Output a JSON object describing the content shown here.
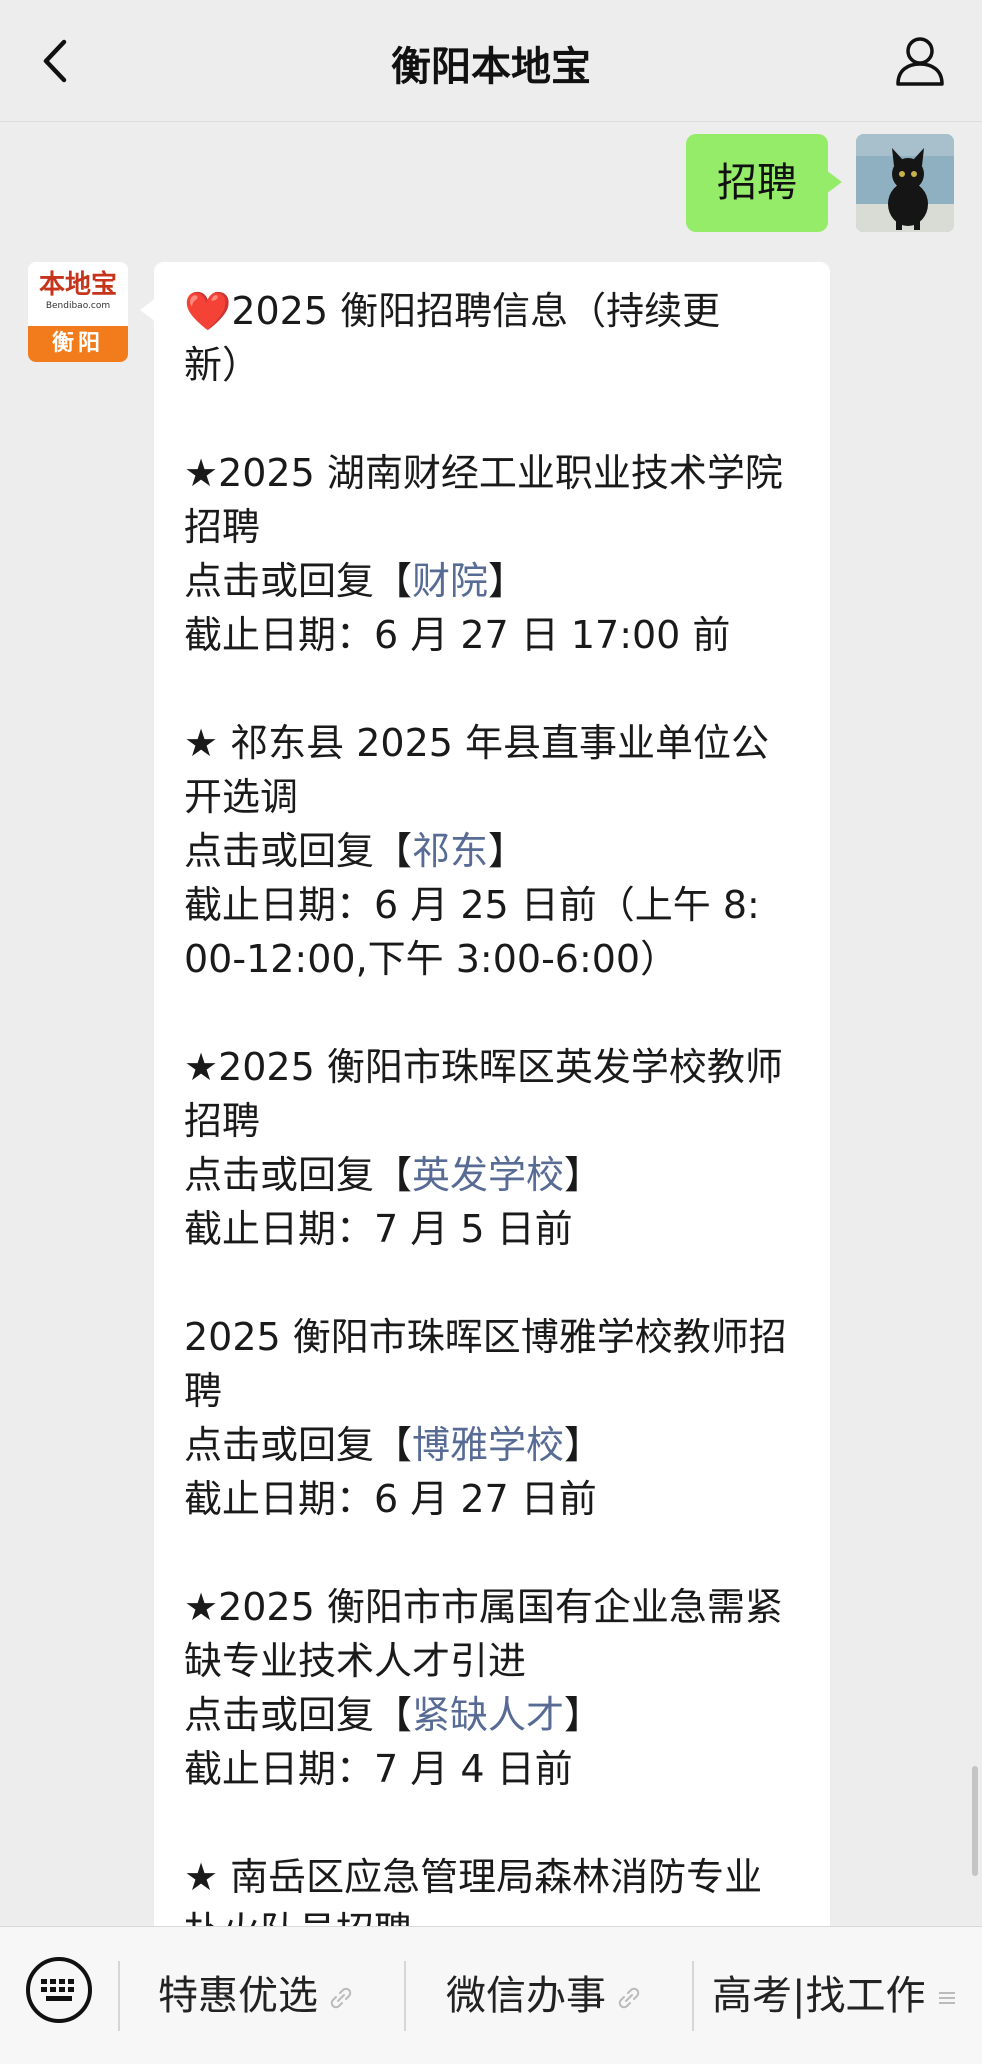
{
  "header": {
    "title": "衡阳本地宝"
  },
  "outgoing_message": {
    "text": "招聘"
  },
  "sender_logo": {
    "main": "本地宝",
    "sub": "Bendibao.com",
    "city": "衡阳"
  },
  "incoming_message": {
    "heart": "❤️",
    "title_line1": "2025 衡阳招聘信息（持续更",
    "title_line2": "新）",
    "items": [
      {
        "title_line1": "★2025 湖南财经工业职业技术学院",
        "title_line2": "招聘",
        "action_prefix": "点击或回复【",
        "keyword": "财院",
        "action_suffix": "】",
        "deadline_line1": "截止日期：6 月 27 日 17:00 前",
        "deadline_line2": ""
      },
      {
        "title_line1": "★ 祁东县 2025 年县直事业单位公",
        "title_line2": "开选调",
        "action_prefix": "点击或回复【",
        "keyword": "祁东",
        "action_suffix": "】",
        "deadline_line1": "截止日期：6 月 25 日前（上午 8:",
        "deadline_line2": "00-12:00,下午 3:00-6:00）"
      },
      {
        "title_line1": "★2025 衡阳市珠晖区英发学校教师",
        "title_line2": "招聘",
        "action_prefix": "点击或回复【",
        "keyword": "英发学校",
        "action_suffix": "】",
        "deadline_line1": "截止日期：7 月 5 日前",
        "deadline_line2": ""
      },
      {
        "title_line1": "2025 衡阳市珠晖区博雅学校教师招",
        "title_line2": "聘",
        "action_prefix": "点击或回复【",
        "keyword": "博雅学校",
        "action_suffix": "】",
        "deadline_line1": "截止日期：6 月 27 日前",
        "deadline_line2": ""
      },
      {
        "title_line1": "★2025 衡阳市市属国有企业急需紧",
        "title_line2": "缺专业技术人才引进",
        "action_prefix": "点击或回复【",
        "keyword": "紧缺人才",
        "action_suffix": "】",
        "deadline_line1": "截止日期：7 月 4 日前",
        "deadline_line2": ""
      }
    ],
    "last_item_line1": "★ 南岳区应急管理局森林消防专业",
    "last_item_line2": "扑火队员招聘"
  },
  "bottom_menu": {
    "items": [
      "特惠优选",
      "微信办事",
      "高考|找工作"
    ]
  },
  "colors": {
    "background": "#ededed",
    "outgoing_bubble": "#95ec69",
    "link": "#576b95",
    "logo_orange": "#f27c1c",
    "logo_red": "#c5341b"
  }
}
